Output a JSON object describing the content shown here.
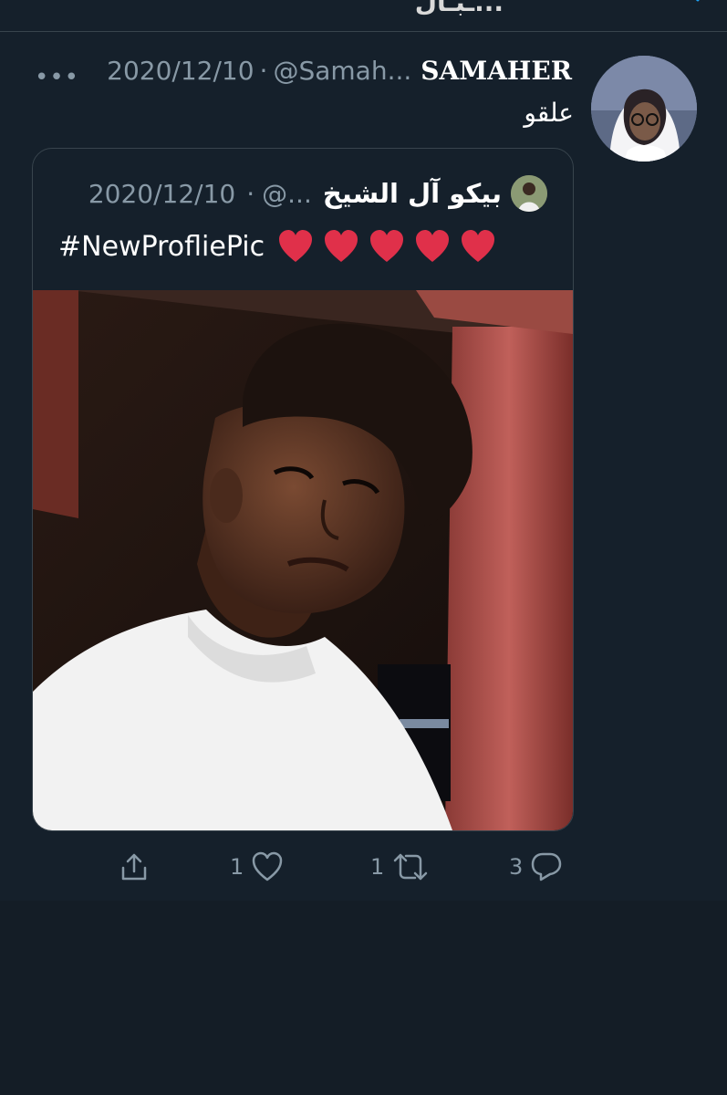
{
  "topbar": {
    "text": "...ـبـال",
    "arrow_icon": "back-arrow-icon"
  },
  "tweet": {
    "author_name": "SAMAHER",
    "author_handle": "@Samah...",
    "separator": "·",
    "date": "2020/12/10",
    "more_label": "•••",
    "text": "علقو"
  },
  "quoted_tweet": {
    "author_name": "بيكو آل الشيخ",
    "author_handle": "@...",
    "separator": "·",
    "date": "2020/12/10",
    "hashtag": "#NewProfliePic",
    "emoji_count": 5
  },
  "actions": {
    "reply_count": "3",
    "retweet_count": "1",
    "like_count": "1"
  },
  "colors": {
    "background": "#15202b",
    "secondary_text": "#8899a6",
    "border": "#38444d",
    "heart": "#e0304a"
  }
}
